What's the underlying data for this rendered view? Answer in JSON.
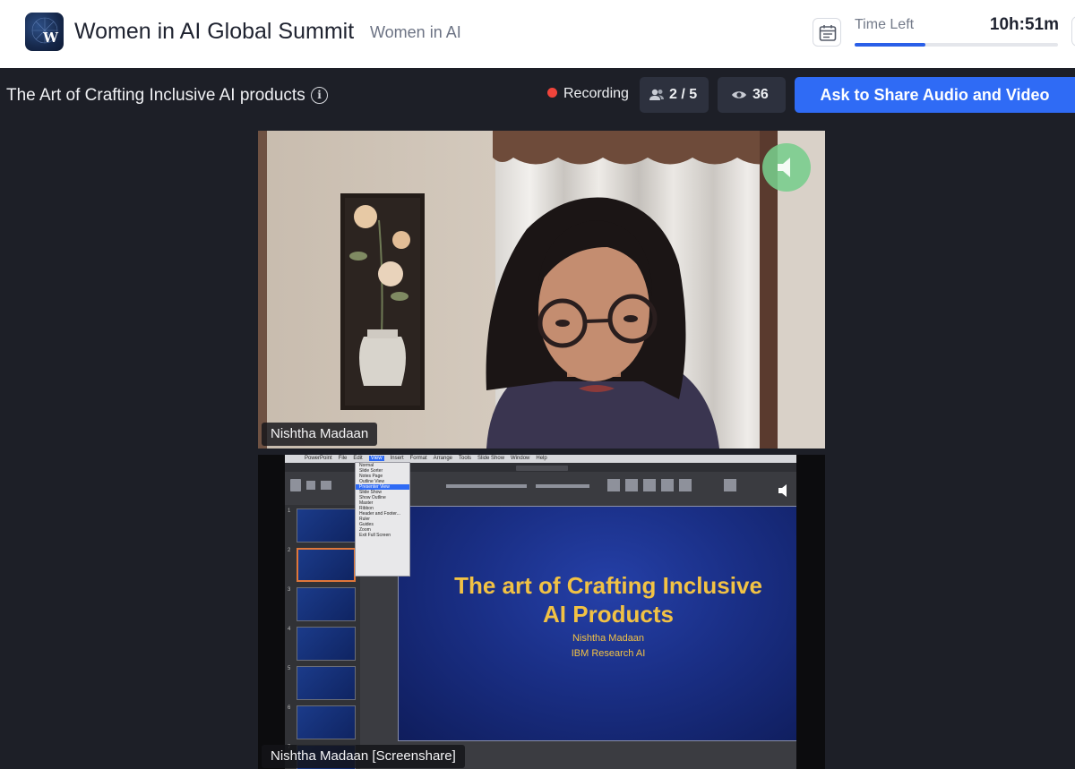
{
  "header": {
    "event_title": "Women in AI Global Summit",
    "org_link": "Women in AI",
    "logo_letter": "W",
    "time_left_label": "Time Left",
    "time_left_value": "10h:51m",
    "time_left_progress": 0.35
  },
  "session": {
    "title": "The Art of Crafting Inclusive AI products",
    "info_icon": "i",
    "recording_label": "Recording",
    "participants": "2 / 5",
    "viewers": "36",
    "share_button": "Ask to Share Audio and Video"
  },
  "speaker": {
    "name": "Nishtha Madaan"
  },
  "screenshare": {
    "name": "Nishtha Madaan [Screenshare]",
    "slide_title_line1": "The art of Crafting Inclusive",
    "slide_title_line2": "AI Products",
    "slide_author": "Nishtha Madaan",
    "slide_affiliation": "IBM Research AI",
    "mac_menu": [
      "PowerPoint",
      "File",
      "Edit",
      "View",
      "Insert",
      "Format",
      "Arrange",
      "Tools",
      "Slide Show",
      "Window",
      "Help"
    ],
    "view_menu": [
      "Normal",
      "Slide Sorter",
      "Notes Page",
      "Outline View",
      "Presenter View",
      "Slide Show",
      "Show Outline",
      "Master",
      "Ribbon",
      "Header and Footer...",
      "Ruler",
      "Guides",
      "Zoom",
      "Exit Full Screen"
    ],
    "thumb_numbers": [
      "1",
      "2",
      "3",
      "4",
      "5",
      "6",
      "7"
    ]
  },
  "colors": {
    "accent": "#2f6bf5",
    "recording": "#f0443b",
    "background": "#1d1f27",
    "slide_text": "#f2c244"
  },
  "icons": {
    "calendar": "calendar-icon",
    "participants": "people-icon",
    "viewers": "eye-icon",
    "speaker_audio": "speaker-icon",
    "info": "info-icon"
  }
}
